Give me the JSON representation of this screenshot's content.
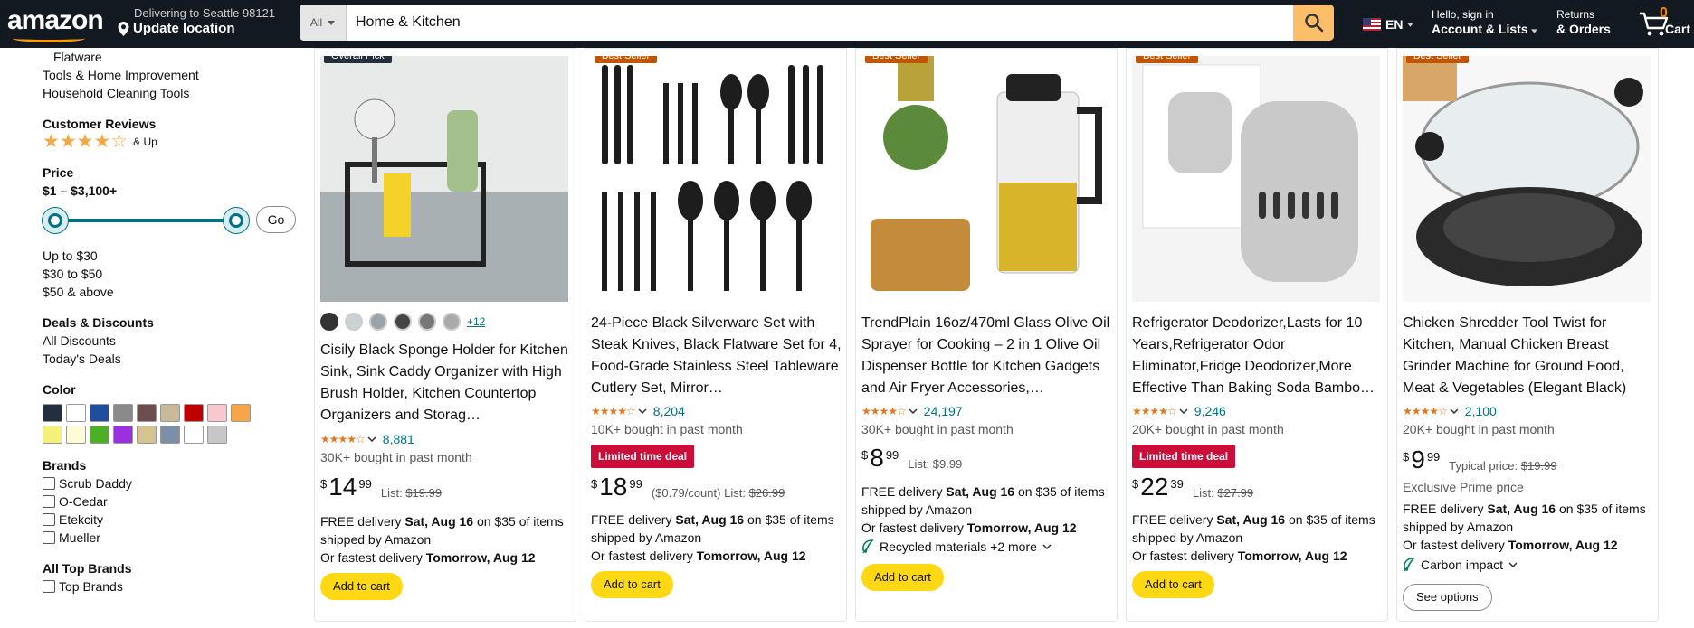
{
  "header": {
    "logo": "amazon",
    "deliver_line1": "Delivering to Seattle 98121",
    "deliver_line2": "Update location",
    "search_category": "All",
    "search_value": "Home & Kitchen",
    "language": "EN",
    "account_line1": "Hello, sign in",
    "account_line2": "Account & Lists",
    "returns_line1": "Returns",
    "returns_line2": "& Orders",
    "cart_count": "0",
    "cart_label": "Cart"
  },
  "sidebar": {
    "category_items": [
      "Flatware",
      "Tools & Home Improvement",
      "Household Cleaning Tools"
    ],
    "reviews_heading": "Customer Reviews",
    "reviews_up": "& Up",
    "price_heading": "Price",
    "price_range": "$1 – $3,100+",
    "go_label": "Go",
    "price_options": [
      "Up to $30",
      "$30 to $50",
      "$50 & above"
    ],
    "deals_heading": "Deals & Discounts",
    "deals_items": [
      "All Discounts",
      "Today's Deals"
    ],
    "color_heading": "Color",
    "colors": [
      "#232f3e",
      "#ffffff",
      "#1f4e9c",
      "#8a8a8a",
      "#6b4f4f",
      "#c8b99a",
      "#c00000",
      "#f8c8d0",
      "#f7a54b",
      "#f4f07a",
      "#fffbd6",
      "#4caf26",
      "#9b30e0",
      "#d6c490",
      "#7d8fa8",
      "#ffffff",
      "#c7c7c7"
    ],
    "brands_heading": "Brands",
    "brands": [
      "Scrub Daddy",
      "O-Cedar",
      "Etekcity",
      "Mueller"
    ],
    "top_brands_heading": "All Top Brands",
    "top_brands": [
      "Top Brands"
    ]
  },
  "products": [
    {
      "badge": "Overall Pick",
      "title": "Cisily Black Sponge Holder for Kitchen Sink, Sink Caddy Organizer with High Brush Holder, Kitchen Countertop Organizers and Storag…",
      "more_colors": "+12",
      "rating_count": "8,881",
      "bought": "30K+ bought in past month",
      "price_whole": "14",
      "price_frac": "99",
      "list_label": "List:",
      "list_price": "$19.99",
      "delivery_prefix": "FREE delivery",
      "delivery_date": "Sat, Aug 16",
      "delivery_suffix": "on $35 of items",
      "shipped": "shipped by Amazon",
      "fastest_prefix": "Or fastest delivery",
      "fastest_date": "Tomorrow, Aug 12",
      "button": "Add to cart"
    },
    {
      "badge": "Best Seller",
      "title": "24-Piece Black Silverware Set with Steak Knives, Black Flatware Set for 4, Food-Grade Stainless Steel Tableware Cutlery Set, Mirror…",
      "rating_count": "8,204",
      "bought": "10K+ bought in past month",
      "deal": "Limited time deal",
      "price_whole": "18",
      "price_frac": "99",
      "unit_price": "($0.79/count)",
      "list_label": "List:",
      "list_price": "$26.99",
      "delivery_prefix": "FREE delivery",
      "delivery_date": "Sat, Aug 16",
      "delivery_suffix": "on $35 of items",
      "shipped": "shipped by Amazon",
      "fastest_prefix": "Or fastest delivery",
      "fastest_date": "Tomorrow, Aug 12",
      "button": "Add to cart"
    },
    {
      "badge": "Best Seller",
      "title": "TrendPlain 16oz/470ml Glass Olive Oil Sprayer for Cooking – 2 in 1 Olive Oil Dispenser Bottle for Kitchen Gadgets and Air Fryer Accessories,…",
      "rating_count": "24,197",
      "bought": "30K+ bought in past month",
      "price_whole": "8",
      "price_frac": "99",
      "list_label": "List:",
      "list_price": "$9.99",
      "delivery_prefix": "FREE delivery",
      "delivery_date": "Sat, Aug 16",
      "delivery_suffix": "on $35 of items",
      "shipped": "shipped by Amazon",
      "fastest_prefix": "Or fastest delivery",
      "fastest_date": "Tomorrow, Aug 12",
      "sustain": "Recycled materials +2 more",
      "button": "Add to cart"
    },
    {
      "badge": "Best Seller",
      "title": "Refrigerator Deodorizer,Lasts for 10 Years,Refrigerator Odor Eliminator,Fridge Deodorizer,More Effective Than Baking Soda Bambo…",
      "rating_count": "9,246",
      "bought": "20K+ bought in past month",
      "deal": "Limited time deal",
      "price_whole": "22",
      "price_frac": "39",
      "list_label": "List:",
      "list_price": "$27.99",
      "delivery_prefix": "FREE delivery",
      "delivery_date": "Sat, Aug 16",
      "delivery_suffix": "on $35 of items",
      "shipped": "shipped by Amazon",
      "fastest_prefix": "Or fastest delivery",
      "fastest_date": "Tomorrow, Aug 12",
      "button": "Add to cart"
    },
    {
      "badge": "Best Seller",
      "title": "Chicken Shredder Tool Twist for Kitchen, Manual Chicken Breast Grinder Machine for Ground Food, Meat & Vegetables (Elegant Black)",
      "rating_count": "2,100",
      "bought": "20K+ bought in past month",
      "price_whole": "9",
      "price_frac": "99",
      "list_label": "Typical price:",
      "list_price": "$19.99",
      "prime_note": "Exclusive Prime price",
      "delivery_prefix": "FREE delivery",
      "delivery_date": "Sat, Aug 16",
      "delivery_suffix": "on $35 of items",
      "shipped": "shipped by Amazon",
      "fastest_prefix": "Or fastest delivery",
      "fastest_date": "Tomorrow, Aug 12",
      "sustain": "Carbon impact",
      "button": "See options"
    }
  ],
  "currency": "$",
  "stars_text": "★★★★☆"
}
